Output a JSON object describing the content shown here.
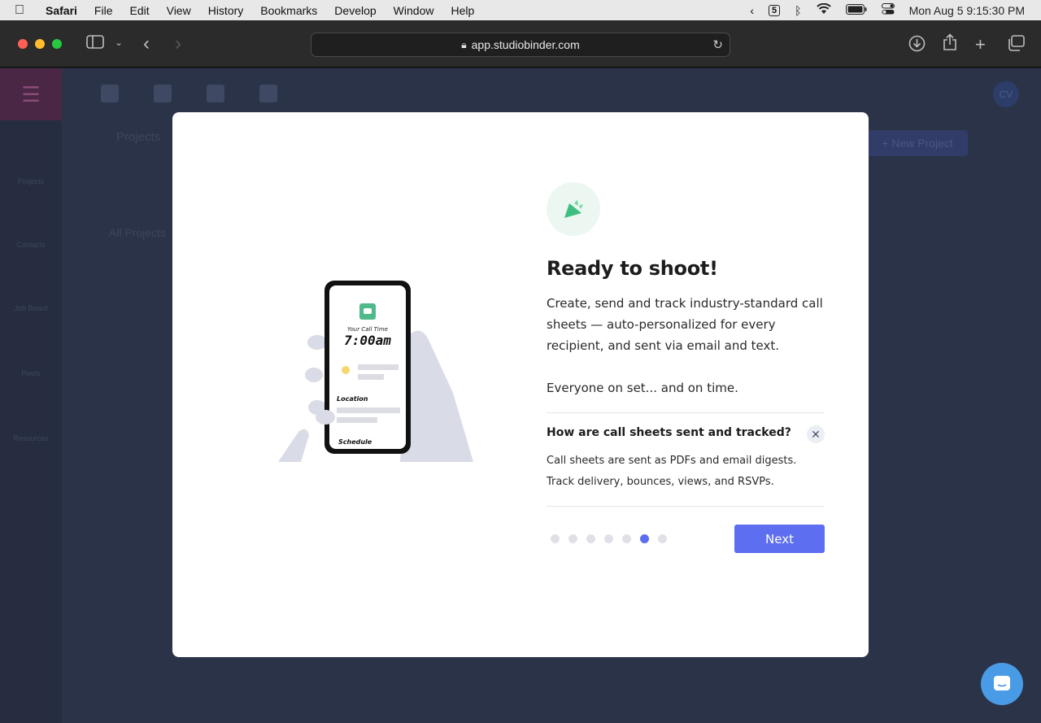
{
  "menubar": {
    "app_name": "Safari",
    "items": [
      "File",
      "Edit",
      "View",
      "History",
      "Bookmarks",
      "Develop",
      "Window",
      "Help"
    ],
    "calendar_badge": "5",
    "datetime": "Mon Aug 5  9:15:30 PM"
  },
  "browser": {
    "url": "app.studiobinder.com"
  },
  "app": {
    "breadcrumb": "Projects",
    "all_projects": "All Projects",
    "new_project": "+ New Project",
    "avatar_initials": "CV",
    "sidebar_labels": [
      "Projects",
      "Contacts",
      "Job Board",
      "Reels",
      "Resources"
    ]
  },
  "modal": {
    "illustration": {
      "call_time_label": "Your Call Time",
      "call_time": "7:00am",
      "location_label": "Location",
      "schedule_label": "Schedule"
    },
    "title": "Ready to shoot!",
    "description": "Create, send and track industry-standard call sheets — auto-personalized for every recipient, and sent via email and text.",
    "tagline": "Everyone on set... and on time.",
    "faq": {
      "question": "How are call sheets sent and tracked?",
      "answer_line1": "Call sheets are sent as PDFs and email digests.",
      "answer_line2": "Track delivery, bounces, views, and RSVPs."
    },
    "pagination": {
      "total": 7,
      "active": 6
    },
    "next_label": "Next"
  },
  "colors": {
    "accent": "#5d6ef1",
    "badge_green": "#3fbf7f"
  }
}
